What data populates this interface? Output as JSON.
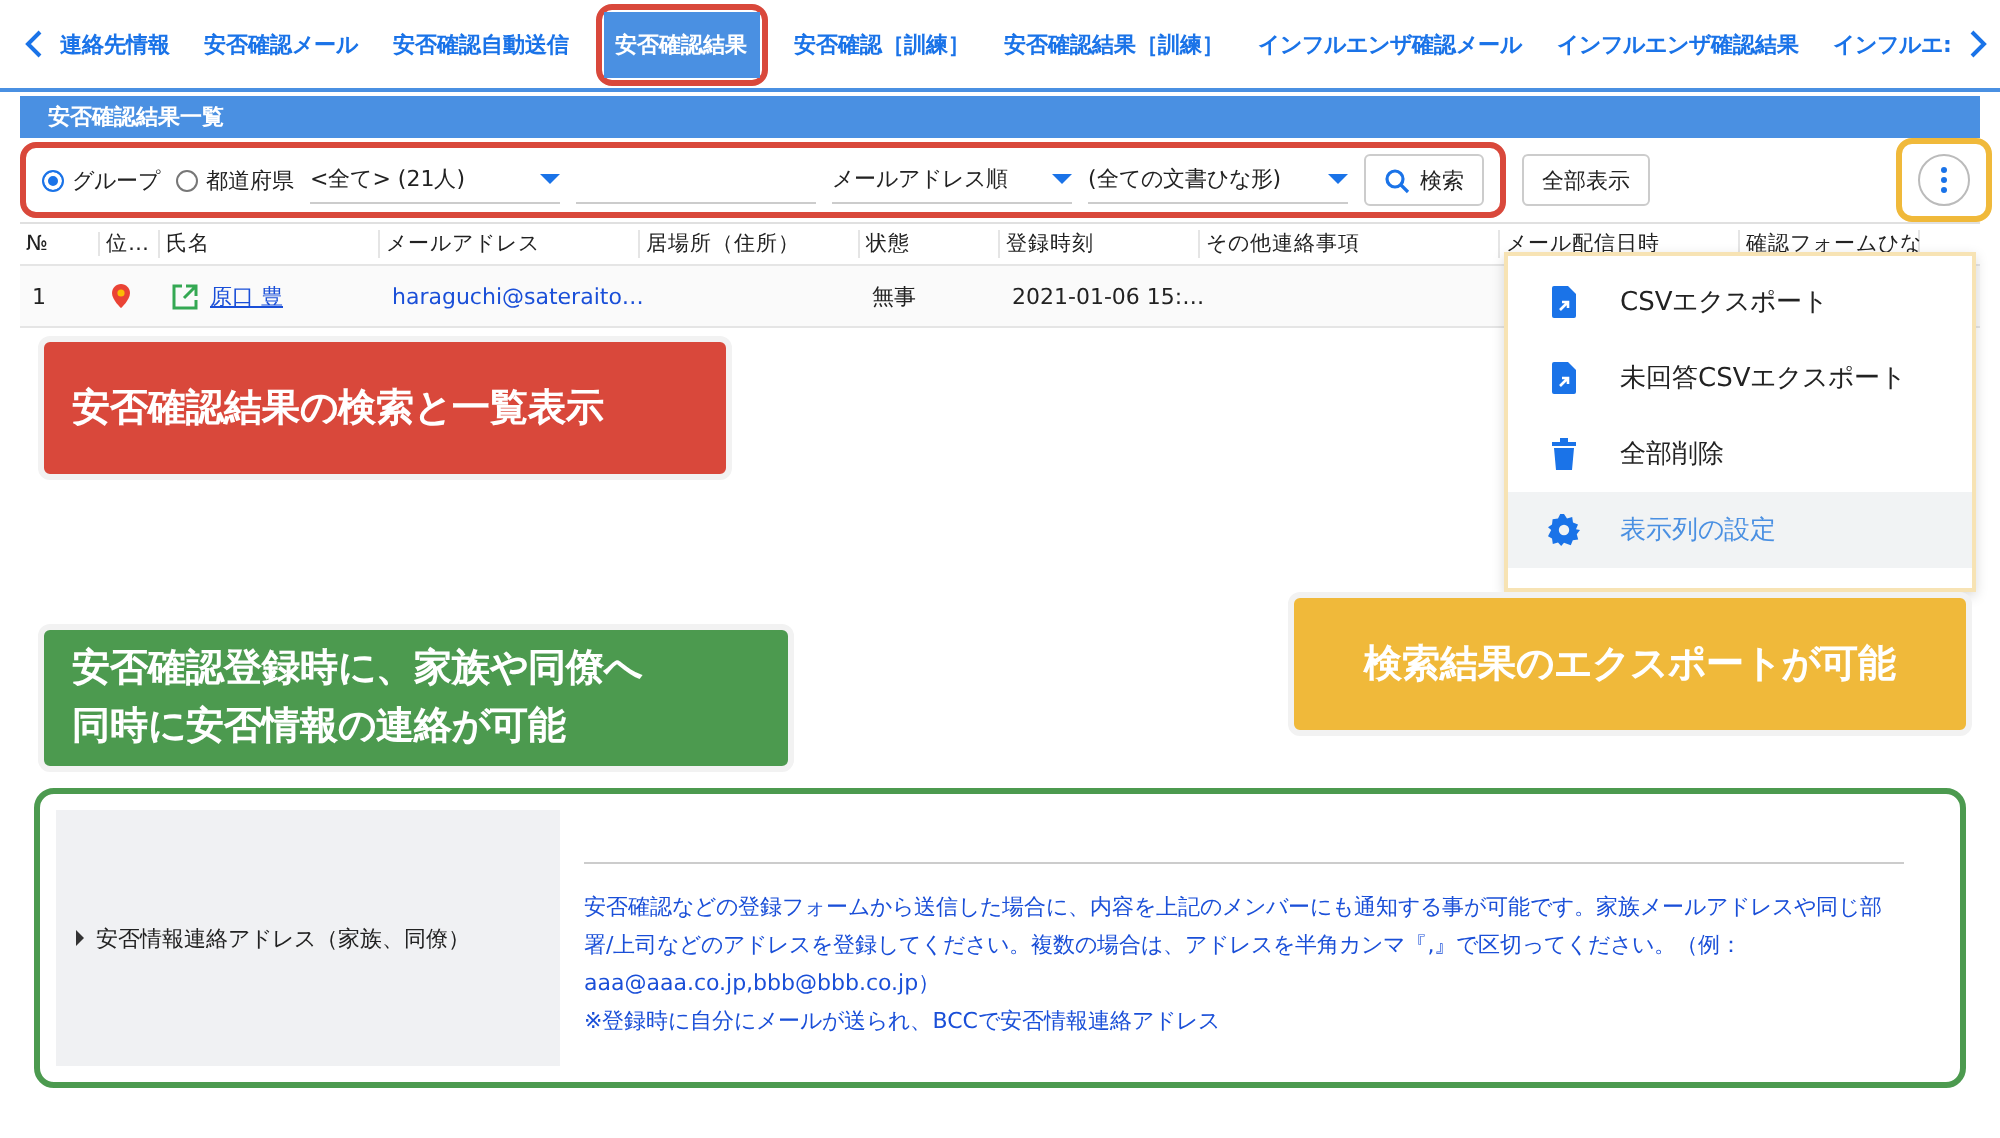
{
  "tabs": [
    {
      "label": "連絡先情報",
      "selected": false
    },
    {
      "label": "安否確認メール",
      "selected": false
    },
    {
      "label": "安否確認自動送信",
      "selected": false
    },
    {
      "label": "安否確認結果",
      "selected": true
    },
    {
      "label": "安否確認［訓練］",
      "selected": false
    },
    {
      "label": "安否確認結果［訓練］",
      "selected": false
    },
    {
      "label": "インフルエンザ確認メール",
      "selected": false
    },
    {
      "label": "インフルエンザ確認結果",
      "selected": false
    },
    {
      "label": "インフルエ:",
      "selected": false
    }
  ],
  "panel_title": "安否確認結果一覧",
  "filters": {
    "radios": [
      {
        "label": "グループ",
        "selected": true
      },
      {
        "label": "都道府県",
        "selected": false
      }
    ],
    "group_select": "<全て> (21人)",
    "sort_select": "メールアドレス順",
    "template_select": "(全ての文書ひな形)",
    "search_button": "検索",
    "show_all_button": "全部表示"
  },
  "table": {
    "columns": [
      "№",
      "位…",
      "氏名",
      "メールアドレス",
      "居場所（住所）",
      "状態",
      "登録時刻",
      "その他連絡事項",
      "メール配信日時",
      "確認フォームひな"
    ],
    "rows": [
      {
        "no": "1",
        "name": "原口 豊",
        "email": "haraguchi@sateraito…",
        "status": "無事",
        "time": "2021-01-06 15:…"
      }
    ]
  },
  "menu": [
    {
      "label": "CSVエクスポート",
      "kind": "file",
      "highlighted": false
    },
    {
      "label": "未回答CSVエクスポート",
      "kind": "file",
      "highlighted": false
    },
    {
      "label": "全部削除",
      "kind": "trash",
      "highlighted": false
    },
    {
      "label": "表示列の設定",
      "kind": "gear",
      "highlighted": true
    }
  ],
  "callouts": [
    {
      "lines": [
        "安否確認結果の検索と一覧表示"
      ],
      "color": "#d9483b"
    },
    {
      "lines": [
        "安否確認登録時に、家族や同僚へ",
        "同時に安否情報の連絡が可能"
      ],
      "color": "#4c9a4f"
    },
    {
      "lines": [
        "検索結果のエクスポートが可能"
      ],
      "color": "#f0b93a"
    }
  ],
  "form": {
    "label": "安否情報連絡アドレス（家族、同僚）",
    "help": [
      "安否確認などの登録フォームから送信した場合に、内容を上記のメンバーにも通知する事が可能です。家族メールアドレスや同じ部署/上司などのアドレスを登録してください。複数の場合は、アドレスを半角カンマ『,』で区切ってください。（例：aaa@aaa.co.jp,bbb@bbb.co.jp）",
      "※登録時に自分にメールが送られ、BCCで安否情報連絡アドレス"
    ]
  }
}
